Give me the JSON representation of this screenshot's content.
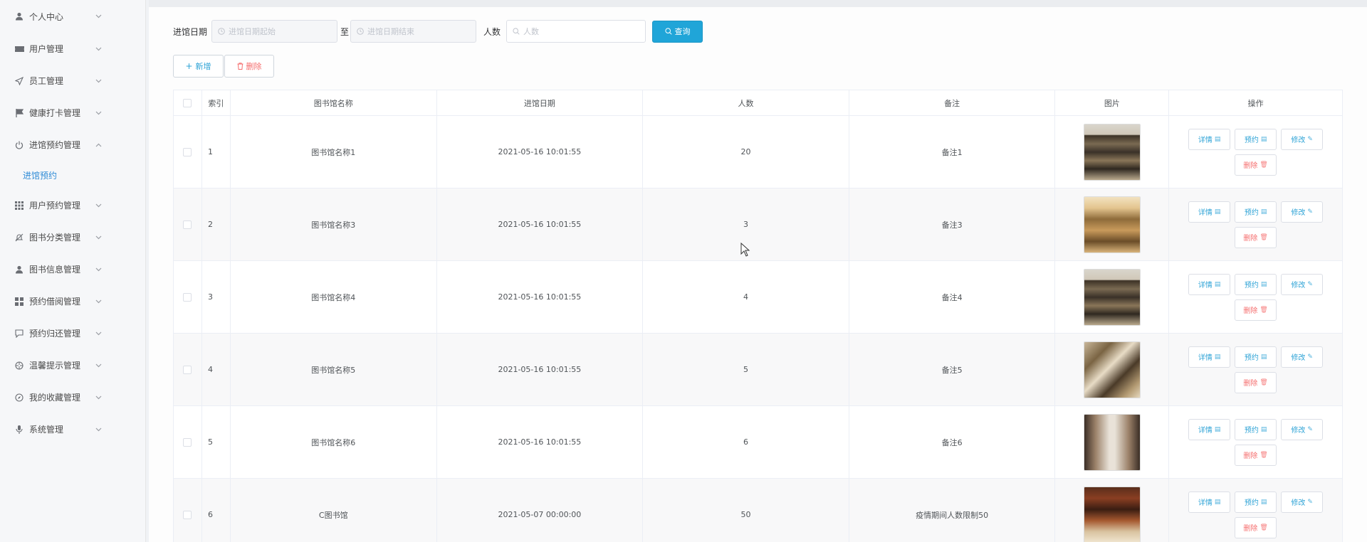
{
  "sidebar": {
    "items": [
      {
        "label": "个人中心",
        "icon": "user-icon",
        "expanded": false
      },
      {
        "label": "用户管理",
        "icon": "ticket-icon",
        "expanded": false
      },
      {
        "label": "员工管理",
        "icon": "send-icon",
        "expanded": false
      },
      {
        "label": "健康打卡管理",
        "icon": "flag-icon",
        "expanded": false
      },
      {
        "label": "进馆预约管理",
        "icon": "power-icon",
        "expanded": true,
        "children": [
          "进馆预约"
        ]
      },
      {
        "label": "用户预约管理",
        "icon": "grid-icon",
        "expanded": false
      },
      {
        "label": "图书分类管理",
        "icon": "bell-icon",
        "expanded": false
      },
      {
        "label": "图书信息管理",
        "icon": "person-icon",
        "expanded": false
      },
      {
        "label": "预约借阅管理",
        "icon": "apps-icon",
        "expanded": false
      },
      {
        "label": "预约归还管理",
        "icon": "chat-icon",
        "expanded": false
      },
      {
        "label": "温馨提示管理",
        "icon": "clock-icon",
        "expanded": false
      },
      {
        "label": "我的收藏管理",
        "icon": "compass-icon",
        "expanded": false
      },
      {
        "label": "系统管理",
        "icon": "mic-icon",
        "expanded": false
      }
    ]
  },
  "search": {
    "date_label": "进馆日期",
    "date_start_placeholder": "进馆日期起始",
    "to_label": "至",
    "date_end_placeholder": "进馆日期结束",
    "count_label": "人数",
    "count_placeholder": "人数",
    "button_label": "查询"
  },
  "actions": {
    "add_label": "新增",
    "delete_label": "删除"
  },
  "table": {
    "columns": [
      "索引",
      "图书馆名称",
      "进馆日期",
      "人数",
      "备注",
      "图片",
      "操作"
    ],
    "rows": [
      {
        "index": "1",
        "name": "图书馆名称1",
        "date": "2021-05-16 10:01:55",
        "count": "20",
        "note": "备注1",
        "image": "library-shelves"
      },
      {
        "index": "2",
        "name": "图书馆名称3",
        "date": "2021-05-16 10:01:55",
        "count": "3",
        "note": "备注3",
        "image": "library-warm"
      },
      {
        "index": "3",
        "name": "图书馆名称4",
        "date": "2021-05-16 10:01:55",
        "count": "4",
        "note": "备注4",
        "image": "library-shelves"
      },
      {
        "index": "4",
        "name": "图书馆名称5",
        "date": "2021-05-16 10:01:55",
        "count": "5",
        "note": "备注5",
        "image": "library-lounge"
      },
      {
        "index": "5",
        "name": "图书馆名称6",
        "date": "2021-05-16 10:01:55",
        "count": "6",
        "note": "备注6",
        "image": "library-atrium"
      },
      {
        "index": "6",
        "name": "C图书馆",
        "date": "2021-05-07 00:00:00",
        "count": "50",
        "note": "疫情期间人数限制50",
        "image": "library-books"
      }
    ],
    "row_actions": {
      "detail": "详情",
      "reserve": "预约",
      "edit": "修改",
      "delete": "删除"
    }
  },
  "colors": {
    "accent": "#20a5d8",
    "danger": "#f56c6c",
    "active_menu": "#2e8bd6"
  }
}
